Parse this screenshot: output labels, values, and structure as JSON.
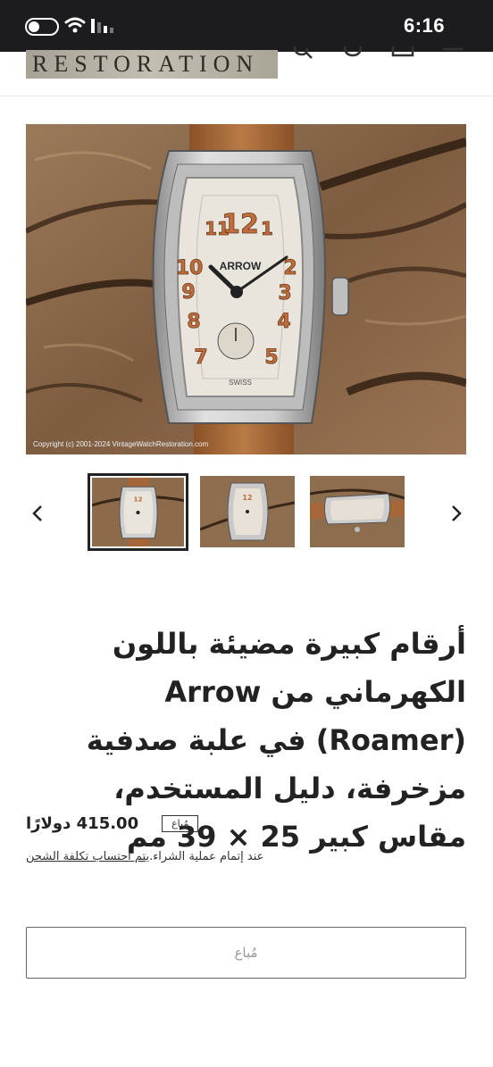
{
  "status_bar": {
    "time": "6:16"
  },
  "header": {
    "logo_text": "RESTORATION"
  },
  "main_image": {
    "copyright": "Copyright (c) 2001-2024 VintageWatchRestoration.com"
  },
  "watch_face": {
    "brand": "ARROW",
    "swiss": "SWISS"
  },
  "product": {
    "title": "أرقام كبيرة مضيئة باللون الكهرماني من Arrow (Roamer) في علبة صدفية مزخرفة، دليل المستخدم، مقاس كبير 25 × 39 مم",
    "price": "415.00 دولارًا",
    "sold_badge": "مُباع",
    "shipping_prefix": "عند إتمام عملية الشراء.",
    "shipping_link": "يتم احتساب تكلفة الشحن",
    "button_label": "مُباع"
  },
  "colors": {
    "status_bg": "#1c1c1e",
    "strap": "#a5673a",
    "wood": "#8a6a4c",
    "dial": "#e9e4dc",
    "numerals": "#c06d3d"
  }
}
